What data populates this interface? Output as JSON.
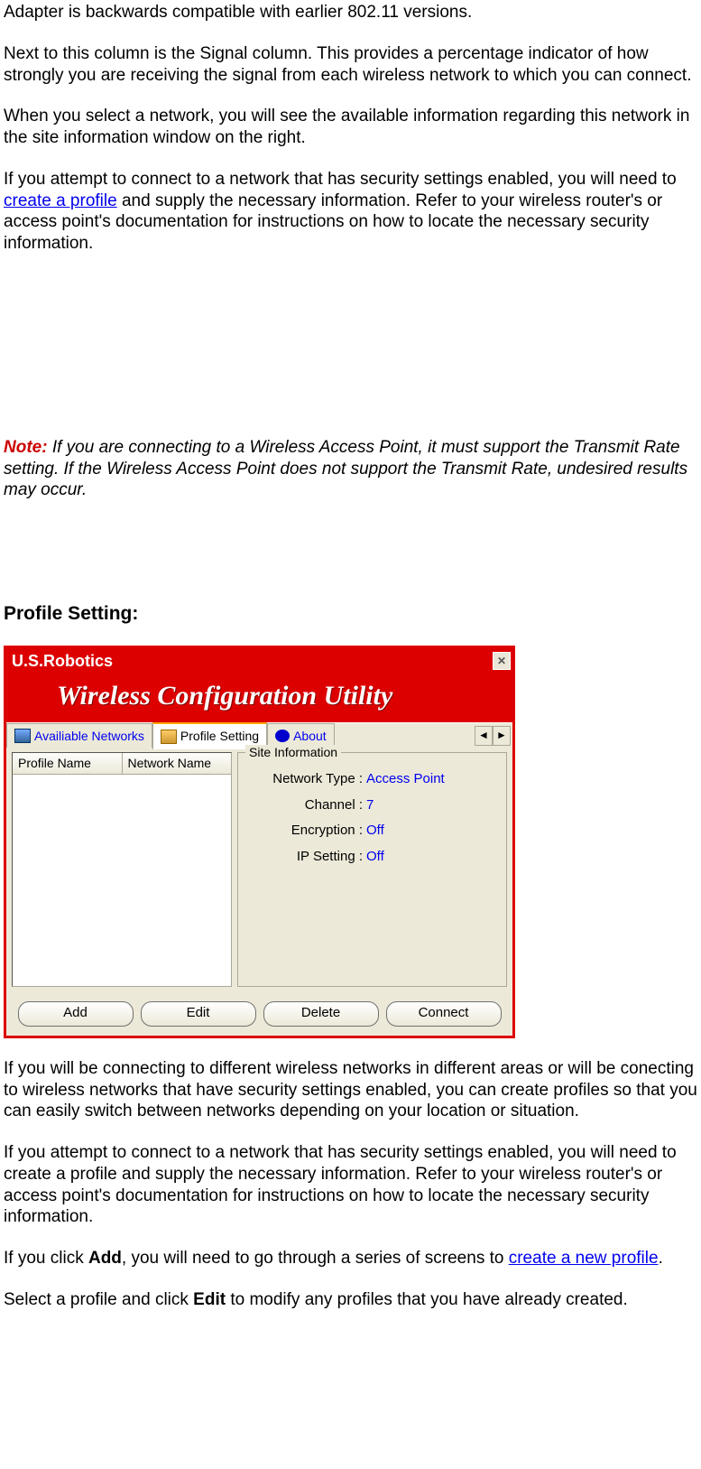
{
  "para1": "Adapter is backwards compatible with earlier 802.11 versions.",
  "para2": "Next to this column is the Signal column. This provides a percentage indicator of how strongly you are receiving the signal from each wireless network to which you can connect.",
  "para3": "When you select a network, you will see the available information regarding this network in the site information window on the right.",
  "para4_a": "If you attempt to connect to a network that has security settings enabled, you will need to ",
  "para4_link": "create a profile",
  "para4_b": " and supply the necessary information. Refer to your wireless router's or access point's documentation for instructions on how to locate the necessary security information.",
  "note_label": "Note:",
  "note_text": " If you are connecting to a Wireless Access Point, it must support the Transmit Rate setting. If the Wireless Access Point does not support the Transmit Rate, undesired results may occur.",
  "heading": "Profile Setting:",
  "util": {
    "logo": "U.S.Robotics",
    "title": "Wireless Configuration Utility",
    "tabs": {
      "avail": "Availiable Networks",
      "profile": "Profile Setting",
      "about": "About"
    },
    "scroll_left": "◄",
    "scroll_right": "►",
    "close": "✕",
    "cols": {
      "profile": "Profile Name",
      "network": "Network Name"
    },
    "fieldset": "Site Information",
    "info": {
      "nettype_l": "Network Type :",
      "nettype_v": "Access Point",
      "channel_l": "Channel :",
      "channel_v": "7",
      "enc_l": "Encryption :",
      "enc_v": "Off",
      "ip_l": "IP Setting :",
      "ip_v": "Off"
    },
    "buttons": {
      "add": "Add",
      "edit": "Edit",
      "delete": "Delete",
      "connect": "Connect"
    }
  },
  "para5": "If you will be connecting to different wireless networks in different areas or will be conecting to wireless networks that have security settings enabled, you can create profiles so that you can easily switch between networks depending on your location or situation.",
  "para6": "If you attempt to connect to a network that has security settings enabled, you will need to create a profile and supply the necessary information. Refer to your wireless router's or access point's documentation for instructions on how to locate the necessary security information.",
  "para7_a": "If you click ",
  "para7_bold": "Add",
  "para7_b": ", you will need to go through a series of screens to ",
  "para7_link": "create a new profile",
  "para7_c": ".",
  "para8_a": "Select a profile and click ",
  "para8_bold": "Edit",
  "para8_b": " to modify any profiles that you have already created."
}
